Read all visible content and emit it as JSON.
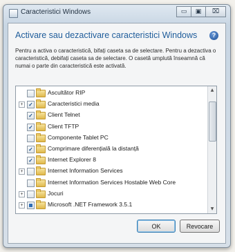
{
  "window": {
    "title": "Caracteristici Windows",
    "controls": {
      "minimize": "▭",
      "maximize": "▣",
      "close": "⌧"
    }
  },
  "header": {
    "title": "Activare sau dezactivare caracteristici Windows",
    "help_icon": "?"
  },
  "description": "Pentru a activa o caracteristică, bifați caseta sa de selectare. Pentru a dezactiva o caracteristică, debifați caseta sa de selectare. O casetă umplută înseamnă că numai o parte din caracteristică este activată.",
  "features": [
    {
      "label": "Ascultător RIP",
      "state": "unchecked",
      "expandable": false
    },
    {
      "label": "Caracteristici media",
      "state": "checked",
      "expandable": true
    },
    {
      "label": "Client Telnet",
      "state": "checked",
      "expandable": false
    },
    {
      "label": "Client TFTP",
      "state": "checked",
      "expandable": false
    },
    {
      "label": "Componente Tablet PC",
      "state": "unchecked",
      "expandable": false
    },
    {
      "label": "Comprimare diferențială la distanță",
      "state": "checked",
      "expandable": false
    },
    {
      "label": "Internet Explorer 8",
      "state": "checked",
      "expandable": false
    },
    {
      "label": "Internet Information Services",
      "state": "unchecked",
      "expandable": true
    },
    {
      "label": "Internet Information Services Hostable Web Core",
      "state": "unchecked",
      "expandable": false
    },
    {
      "label": "Jocuri",
      "state": "unchecked",
      "expandable": true
    },
    {
      "label": "Microsoft .NET Framework 3.5.1",
      "state": "partial",
      "expandable": true
    }
  ],
  "buttons": {
    "ok": "OK",
    "cancel": "Revocare"
  },
  "colors": {
    "heading": "#1e5c9a",
    "check": "#1d4f8a",
    "partial": "#2f6db5"
  }
}
